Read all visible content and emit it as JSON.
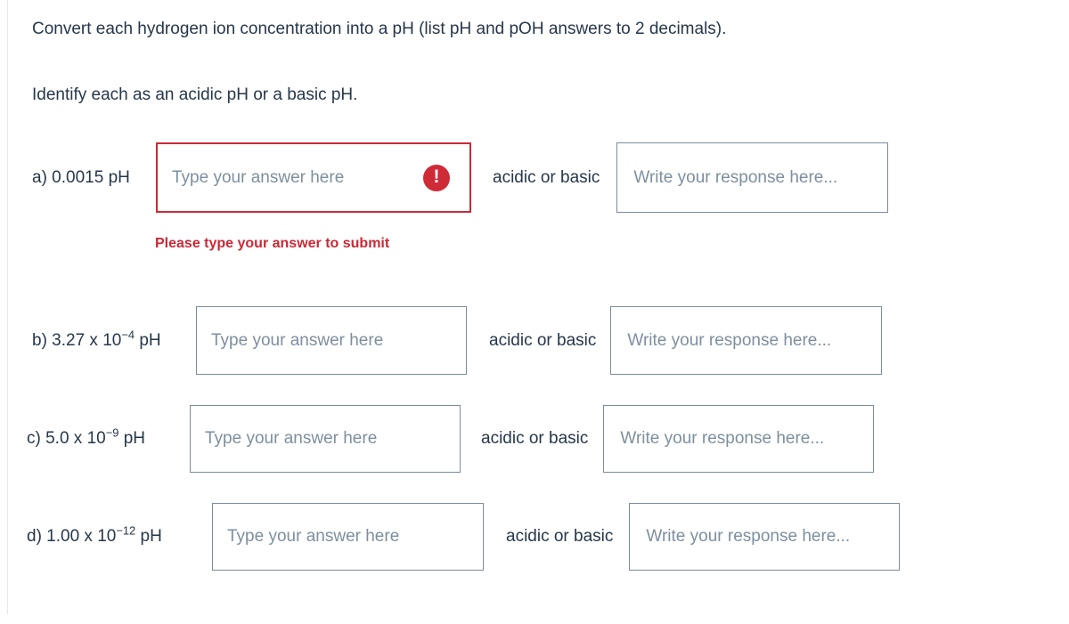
{
  "prompt": {
    "line1": "Convert each hydrogen ion concentration into a pH (list pH and pOH answers to 2 decimals).",
    "line2": "Identify each as an acidic pH or a basic pH."
  },
  "colors": {
    "text": "#26374a",
    "error": "#cc2936",
    "error_icon": "#ce2b37",
    "focus_border": "#2b6cd4",
    "input_border": "#7a8c9e",
    "placeholder": "#7d8f9f"
  },
  "common": {
    "answer_placeholder": "Type your answer here",
    "response_placeholder": "Write your response here...",
    "acid_base_label": "acidic or basic",
    "error_icon_name": "error-exclamation-icon",
    "error_icon_glyph": "!"
  },
  "rows": [
    {
      "id": "a",
      "label_prefix": "a) 0.0015",
      "label_mantissa": "0.0015",
      "label_base": "",
      "label_exponent": "",
      "label_unit": "pH",
      "label_full": "a) 0.0015 pH",
      "answer_value": "",
      "answer_placeholder": "Type your answer here",
      "answer_state": "error",
      "error_message": "Please type your answer to submit",
      "acid_base_label": "acidic or basic",
      "response_value": "",
      "response_placeholder": "Write your response here...",
      "response_state": "focused"
    },
    {
      "id": "b",
      "label_prefix": "b) 3.27 x 10",
      "label_mantissa": "3.27",
      "label_base": "10",
      "label_exponent": "−4",
      "label_unit": "pH",
      "label_full": "b) 3.27 x 10−4 pH",
      "answer_value": "",
      "answer_placeholder": "Type your answer here",
      "answer_state": "default",
      "error_message": "",
      "acid_base_label": "acidic or basic",
      "response_value": "",
      "response_placeholder": "Write your response here...",
      "response_state": "default"
    },
    {
      "id": "c",
      "label_prefix": "c) 5.0 x 10",
      "label_mantissa": "5.0",
      "label_base": "10",
      "label_exponent": "−9",
      "label_unit": "pH",
      "label_full": "c) 5.0 x 10−9 pH",
      "answer_value": "",
      "answer_placeholder": "Type your answer here",
      "answer_state": "default",
      "error_message": "",
      "acid_base_label": "acidic or basic",
      "response_value": "",
      "response_placeholder": "Write your response here...",
      "response_state": "default"
    },
    {
      "id": "d",
      "label_prefix": "d) 1.00 x 10",
      "label_mantissa": "1.00",
      "label_base": "10",
      "label_exponent": "−12",
      "label_unit": "pH",
      "label_full": "d) 1.00 x 10−12 pH",
      "answer_value": "",
      "answer_placeholder": "Type your answer here",
      "answer_state": "default",
      "error_message": "",
      "acid_base_label": "acidic or basic",
      "response_value": "",
      "response_placeholder": "Write your response here...",
      "response_state": "default"
    }
  ]
}
